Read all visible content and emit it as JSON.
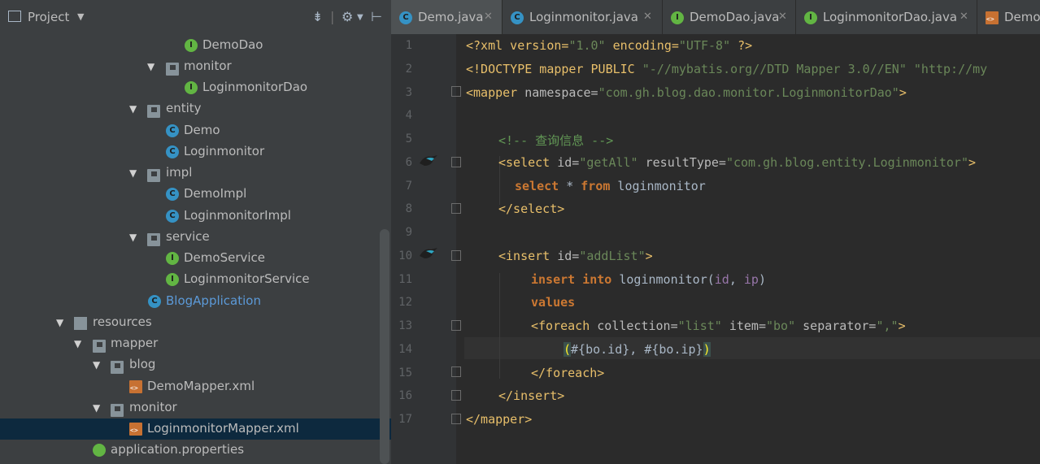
{
  "project": {
    "title": "Project",
    "tree": [
      {
        "label": "DemoDao",
        "icon": "interface-icon"
      },
      {
        "label": "monitor",
        "icon": "package-icon"
      },
      {
        "label": "LoginmonitorDao",
        "icon": "interface-icon"
      },
      {
        "label": "entity",
        "icon": "package-icon"
      },
      {
        "label": "Demo",
        "icon": "class-icon"
      },
      {
        "label": "Loginmonitor",
        "icon": "class-icon"
      },
      {
        "label": "impl",
        "icon": "package-icon"
      },
      {
        "label": "DemoImpl",
        "icon": "class-icon"
      },
      {
        "label": "LoginmonitorImpl",
        "icon": "class-icon"
      },
      {
        "label": "service",
        "icon": "package-icon"
      },
      {
        "label": "DemoService",
        "icon": "interface-icon"
      },
      {
        "label": "LoginmonitorService",
        "icon": "interface-icon"
      },
      {
        "label": "BlogApplication",
        "icon": "spring-app-icon"
      },
      {
        "label": "resources",
        "icon": "resources-folder-icon"
      },
      {
        "label": "mapper",
        "icon": "folder-icon"
      },
      {
        "label": "blog",
        "icon": "folder-icon"
      },
      {
        "label": "DemoMapper.xml",
        "icon": "xml-file-icon"
      },
      {
        "label": "monitor",
        "icon": "folder-icon"
      },
      {
        "label": "LoginmonitorMapper.xml",
        "icon": "xml-file-icon",
        "selected": true
      },
      {
        "label": "application.properties",
        "icon": "properties-file-icon"
      }
    ]
  },
  "tabs": [
    {
      "label": "Demo.java",
      "icon": "class-icon"
    },
    {
      "label": "Loginmonitor.java",
      "icon": "class-icon"
    },
    {
      "label": "DemoDao.java",
      "icon": "interface-icon"
    },
    {
      "label": "LoginmonitorDao.java",
      "icon": "interface-icon"
    },
    {
      "label": "Demo",
      "icon": "xml-file-icon"
    }
  ],
  "editor": {
    "line_numbers": [
      "1",
      "2",
      "3",
      "4",
      "5",
      "6",
      "7",
      "8",
      "9",
      "10",
      "11",
      "12",
      "13",
      "14",
      "15",
      "16",
      "17"
    ],
    "lines": {
      "l1": {
        "a": "<?xml version=",
        "b": "\"1.0\"",
        "c": " encoding=",
        "d": "\"UTF-8\"",
        "e": " ?>"
      },
      "l2": {
        "a": "<!DOCTYPE mapper PUBLIC ",
        "b": "\"-//mybatis.org//DTD Mapper 3.0//EN\"",
        "c": " ",
        "d": "\"http://my"
      },
      "l3": {
        "a": "<mapper ",
        "b": "namespace=",
        "c": "\"com.gh.blog.dao.monitor.LoginmonitorDao\"",
        "d": ">"
      },
      "l5": {
        "a": "<!-- 查询信息 -->"
      },
      "l6": {
        "a": "<select ",
        "b": "id=",
        "c": "\"getAll\"",
        "d": " resultType=",
        "e": "\"com.gh.blog.entity.Loginmonitor\"",
        "f": ">"
      },
      "l7": {
        "a": "select",
        "b": " * ",
        "c": "from",
        "d": " loginmonitor"
      },
      "l8": {
        "a": "</select>"
      },
      "l10": {
        "a": "<insert ",
        "b": "id=",
        "c": "\"addList\"",
        "d": ">"
      },
      "l11": {
        "a": "insert",
        "b": " ",
        "c": "into",
        "d": " loginmonitor(",
        "e": "id",
        "f": ", ",
        "g": "ip",
        "h": ")"
      },
      "l12": {
        "a": "values"
      },
      "l13": {
        "a": "<foreach ",
        "b": "collection=",
        "c": "\"list\"",
        "d": " item=",
        "e": "\"bo\"",
        "f": " separator=",
        "g": "\",\"",
        "h": ">"
      },
      "l14": {
        "a": "(",
        "b": "#{bo.id}, #{bo.ip}",
        "c": ")"
      },
      "l15": {
        "a": "</foreach>"
      },
      "l16": {
        "a": "</insert>"
      },
      "l17": {
        "a": "</mapper>"
      }
    }
  }
}
